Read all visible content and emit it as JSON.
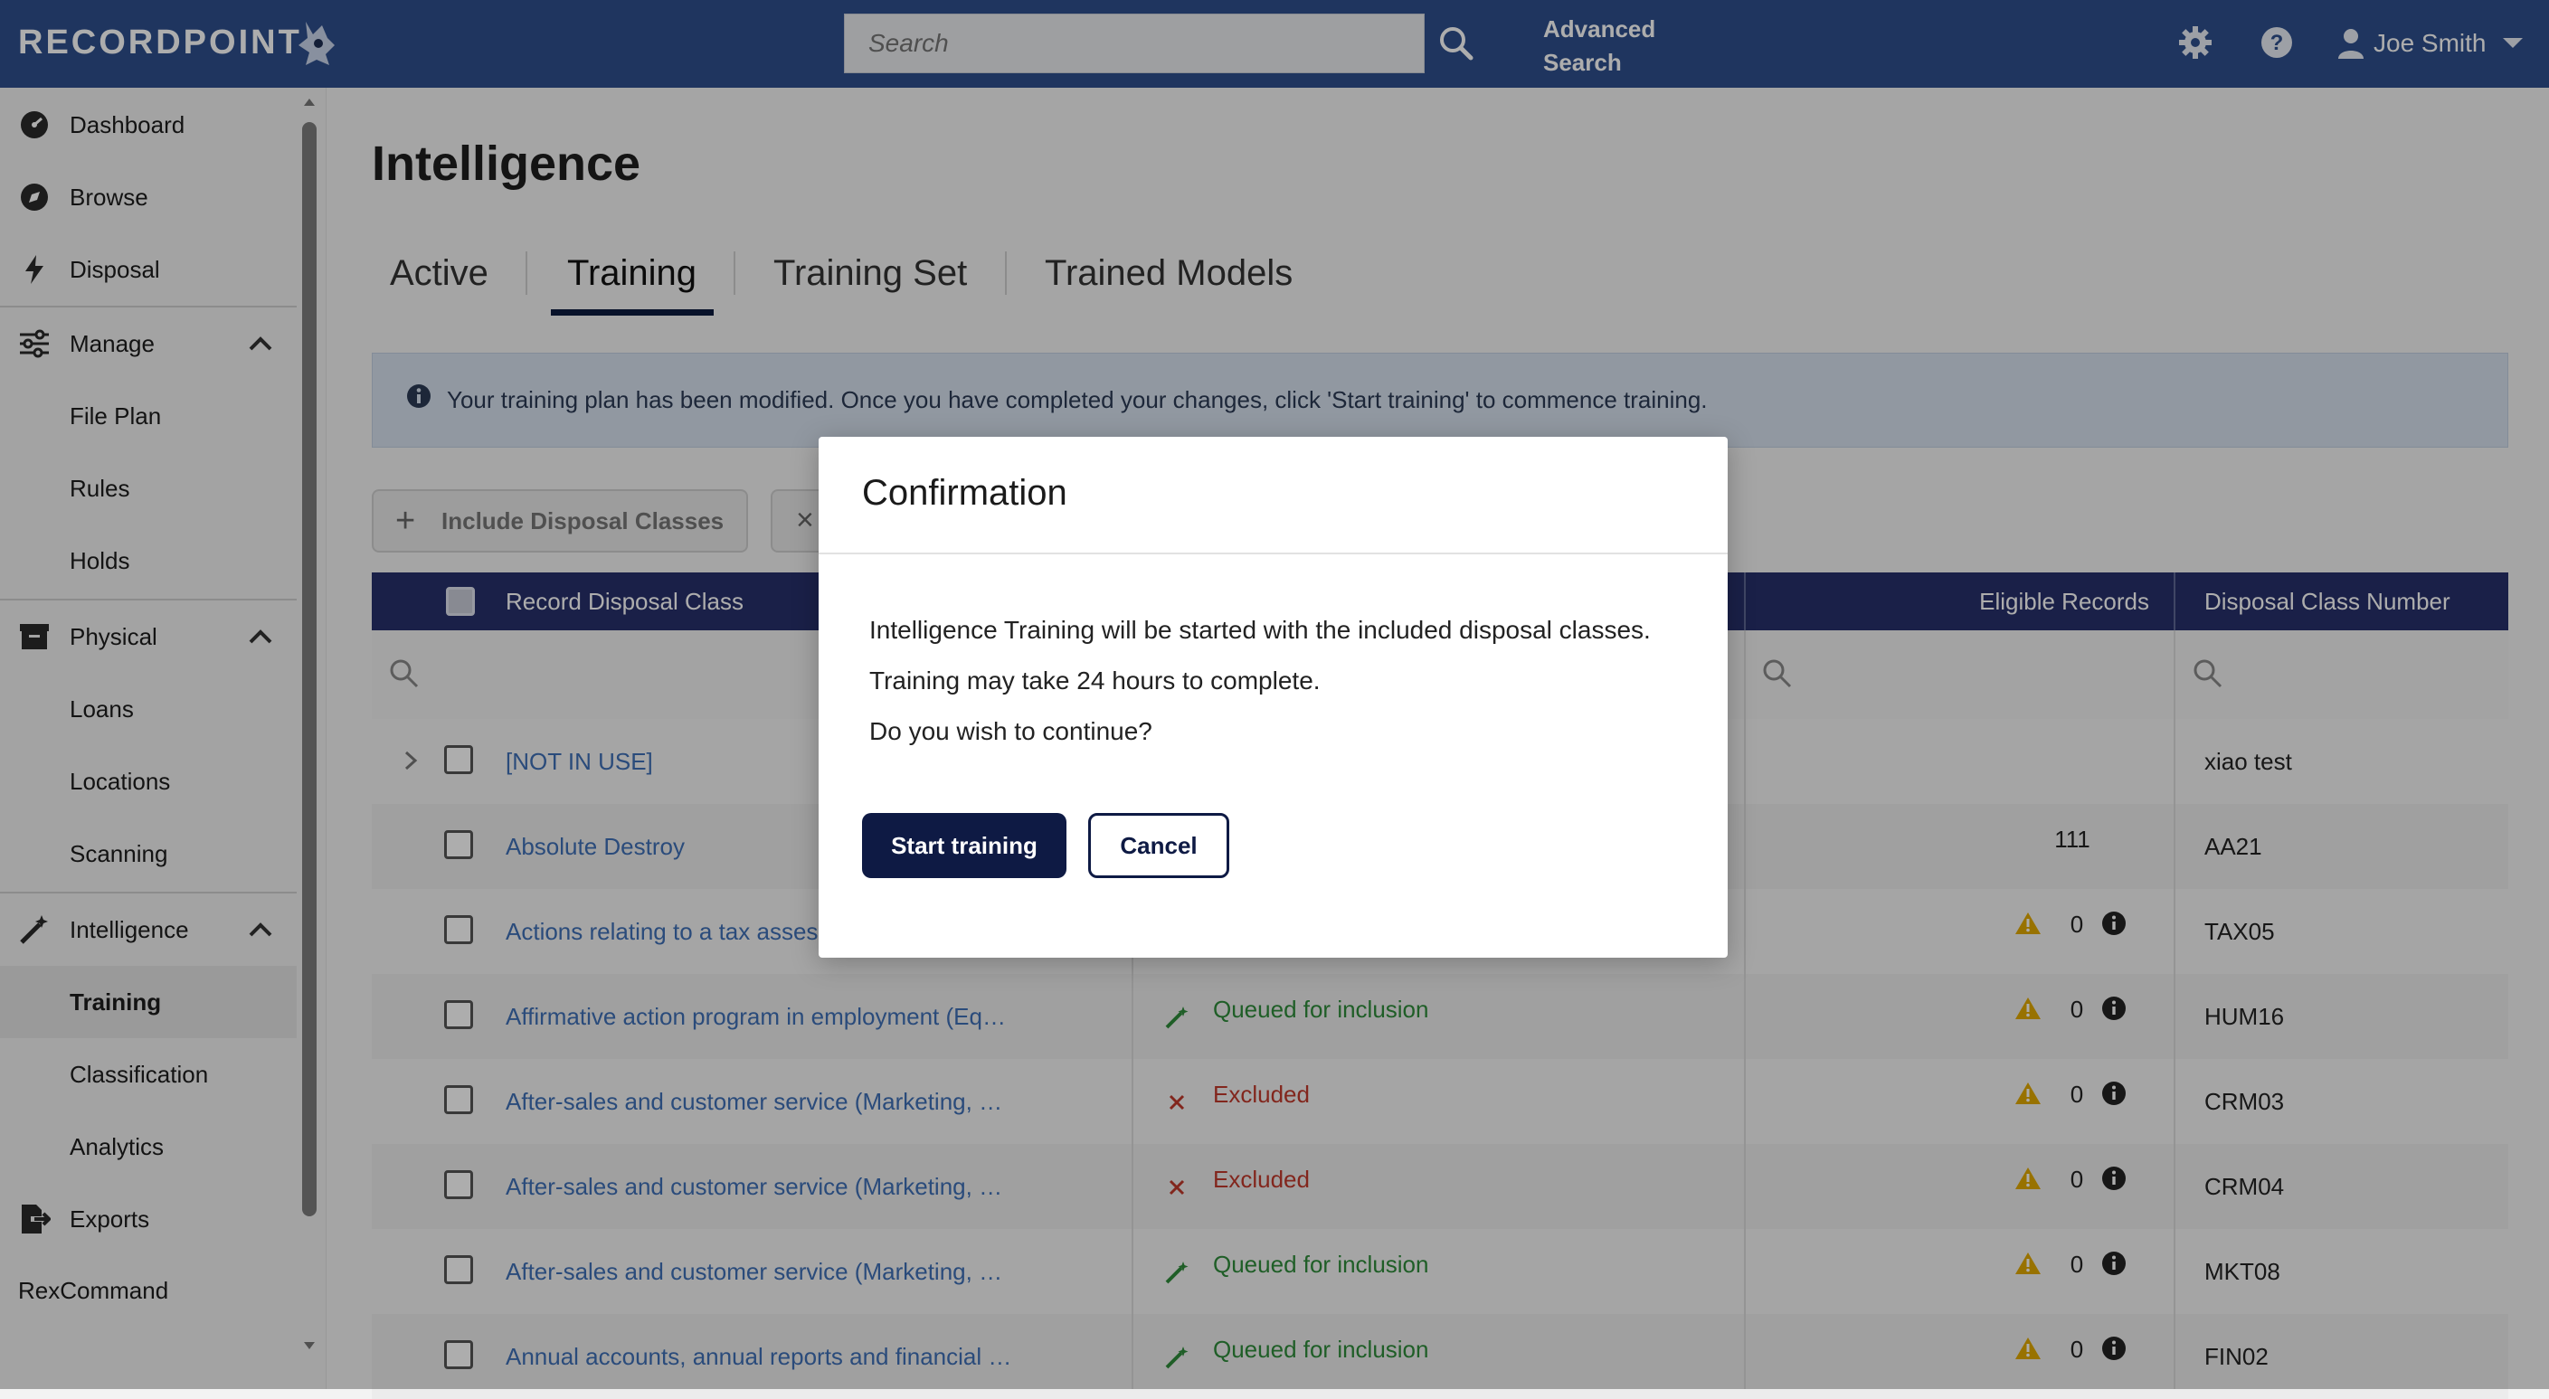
{
  "app": {
    "logo": "RECORDPOINT",
    "search_placeholder": "Search",
    "advanced_search": "Advanced Search",
    "user_name": "Joe Smith"
  },
  "sidebar": {
    "items": [
      {
        "label": "Dashboard",
        "icon": "dashboard-icon"
      },
      {
        "label": "Browse",
        "icon": "compass-icon"
      },
      {
        "label": "Disposal",
        "icon": "lightning-icon"
      },
      {
        "label": "Manage",
        "icon": "sliders-icon",
        "expanded": true
      },
      {
        "label": "File Plan"
      },
      {
        "label": "Rules"
      },
      {
        "label": "Holds"
      },
      {
        "label": "Physical",
        "icon": "archive-box-icon",
        "expanded": true
      },
      {
        "label": "Loans"
      },
      {
        "label": "Locations"
      },
      {
        "label": "Scanning"
      },
      {
        "label": "Intelligence",
        "icon": "magic-wand-icon",
        "expanded": true
      },
      {
        "label": "Training",
        "active": true
      },
      {
        "label": "Classification"
      },
      {
        "label": "Analytics"
      },
      {
        "label": "Exports",
        "icon": "export-icon"
      },
      {
        "label": "RexCommand"
      }
    ]
  },
  "page": {
    "title": "Intelligence",
    "tabs": [
      "Active",
      "Training",
      "Training Set",
      "Trained Models"
    ],
    "active_tab": "Training",
    "banner": "Your training plan has been modified. Once you have completed your changes, click 'Start training' to commence training.",
    "include_button": "Include Disposal Classes",
    "exclude_button": "×"
  },
  "grid": {
    "columns": {
      "record_disposal_class": "Record Disposal Class",
      "eligible_records": "Eligible Records",
      "disposal_class_number": "Disposal Class Number"
    },
    "rows": [
      {
        "name": "[NOT IN USE]",
        "status": "",
        "status_type": "",
        "count": "",
        "dcn": "xiao test",
        "expandable": true
      },
      {
        "name": "Absolute Destroy",
        "status": "",
        "status_type": "",
        "count": "111",
        "dcn": "AA21"
      },
      {
        "name": "Actions relating to a tax assessment",
        "status": "",
        "status_type": "",
        "count": "0",
        "dcn": "TAX05"
      },
      {
        "name": "Affirmative action program in employment (Equal treatment)",
        "status": "Queued for inclusion",
        "status_type": "queued",
        "count": "0",
        "dcn": "HUM16"
      },
      {
        "name": "After-sales and customer service (Marketing, sales, customer)",
        "status": "Excluded",
        "status_type": "excluded",
        "count": "0",
        "dcn": "CRM03"
      },
      {
        "name": "After-sales and customer service (Marketing, sales, customer)",
        "status": "Excluded",
        "status_type": "excluded",
        "count": "0",
        "dcn": "CRM04"
      },
      {
        "name": "After-sales and customer service (Marketing, sales, customer)",
        "status": "Queued for inclusion",
        "status_type": "queued",
        "count": "0",
        "dcn": "MKT08"
      },
      {
        "name": "Annual accounts, annual reports and financial statements",
        "status": "Queued for inclusion",
        "status_type": "queued",
        "count": "0",
        "dcn": "FIN02"
      }
    ]
  },
  "modal": {
    "title": "Confirmation",
    "line1": "Intelligence Training will be started with the included disposal classes.",
    "line2": "Training may take 24 hours to complete.",
    "line3": "Do you wish to continue?",
    "confirm": "Start training",
    "cancel": "Cancel"
  },
  "colors": {
    "topbar": "#2e4f8c",
    "grid_header": "#27306b",
    "primary_button": "#0e1a44",
    "queued": "#2e8b3a",
    "excluded": "#c0392b",
    "link": "#3f6fb5",
    "warning": "#e1a800"
  }
}
